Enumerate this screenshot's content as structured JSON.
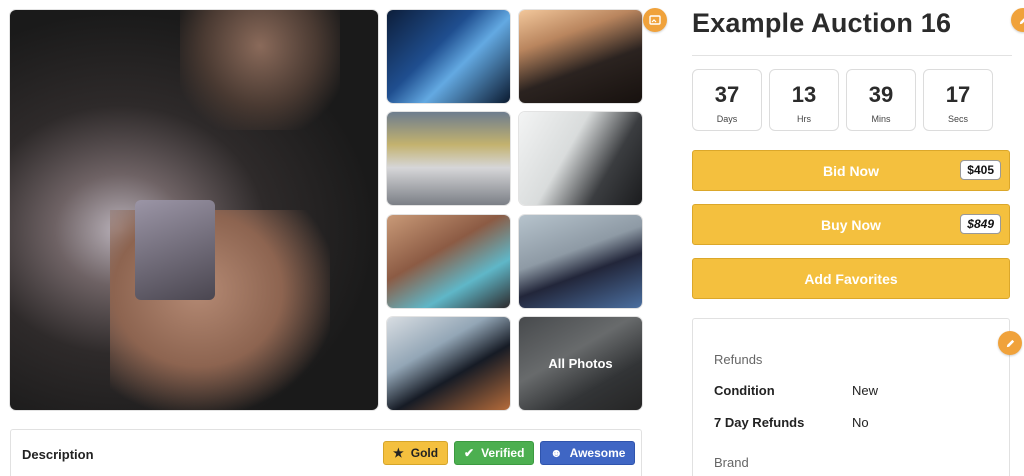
{
  "auction": {
    "title": "Example Auction 16"
  },
  "countdown": [
    {
      "value": "37",
      "label": "Days"
    },
    {
      "value": "13",
      "label": "Hrs"
    },
    {
      "value": "39",
      "label": "Mins"
    },
    {
      "value": "17",
      "label": "Secs"
    }
  ],
  "actions": {
    "bid_label": "Bid Now",
    "bid_price": "$405",
    "buy_label": "Buy Now",
    "buy_price": "$849",
    "favorites_label": "Add Favorites"
  },
  "gallery": {
    "all_photos_label": "All Photos"
  },
  "details": {
    "refunds_heading": "Refunds",
    "rows": [
      {
        "key": "Condition",
        "value": "New"
      },
      {
        "key": "7 Day Refunds",
        "value": "No"
      }
    ],
    "brand_heading": "Brand"
  },
  "description": {
    "title": "Description",
    "badges": [
      {
        "label": "Gold",
        "icon": "star-icon",
        "color": "#f4c03e"
      },
      {
        "label": "Verified",
        "icon": "check-icon",
        "color": "#4caf50"
      },
      {
        "label": "Awesome",
        "icon": "smile-icon",
        "color": "#3f66c4"
      }
    ]
  },
  "colors": {
    "accent": "#f4c03e",
    "edit": "#f0a23b"
  }
}
